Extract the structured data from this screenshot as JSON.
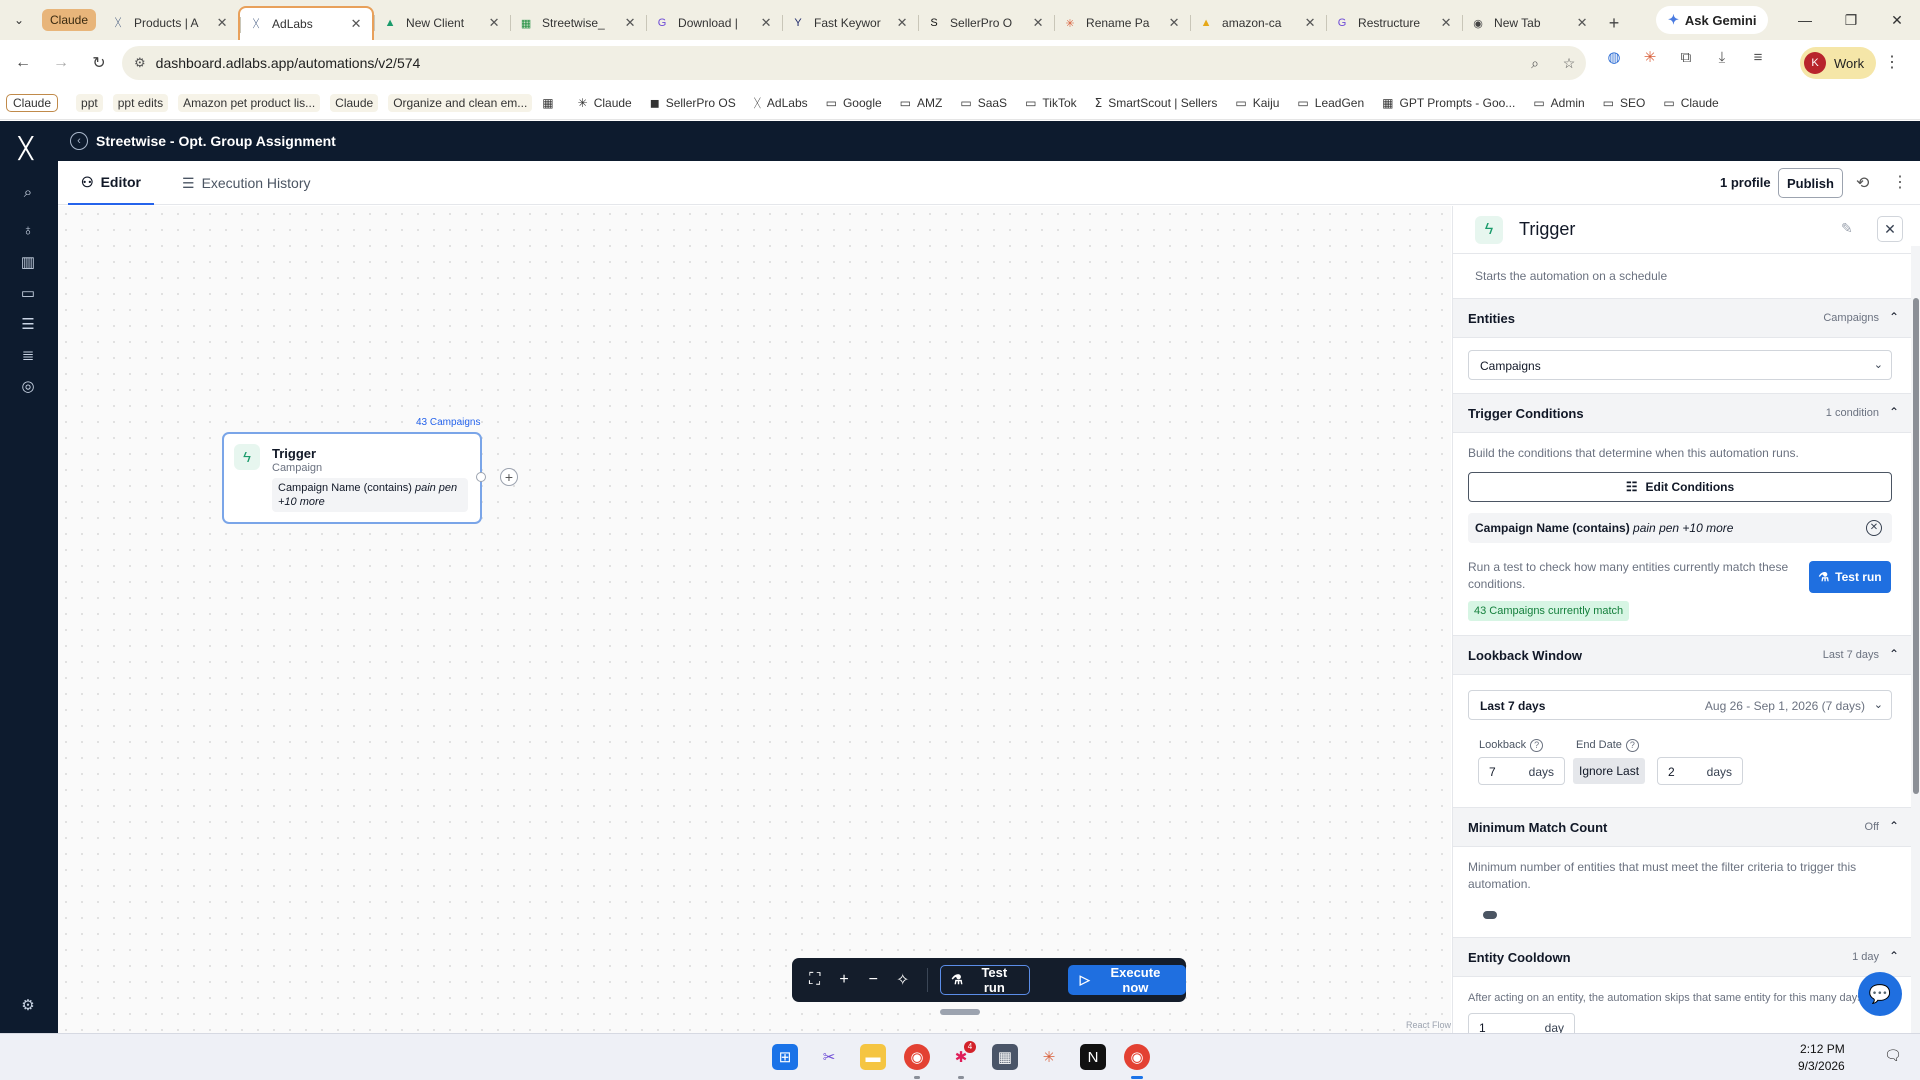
{
  "browser": {
    "tab_group_label": "Claude",
    "tabs": [
      {
        "title": "Products | A",
        "favicon": "adlabs-icon",
        "fav_char": "ᚷ",
        "fav_color": "#1f3a68",
        "active": false
      },
      {
        "title": "AdLabs",
        "favicon": "adlabs-icon",
        "fav_char": "ᚷ",
        "fav_color": "#1f3a68",
        "active": true
      },
      {
        "title": "New Client",
        "favicon": "google-drive-icon",
        "fav_char": "▲",
        "fav_color": "#1a9b6b",
        "active": false
      },
      {
        "title": "Streetwise_",
        "favicon": "google-sheets-icon",
        "fav_char": "▦",
        "fav_color": "#1e8e3e",
        "active": false
      },
      {
        "title": "Download |",
        "favicon": "g-icon",
        "fav_char": "G",
        "fav_color": "#6d4ad6",
        "active": false
      },
      {
        "title": "Fast Keywor",
        "favicon": "y-icon",
        "fav_char": "Y",
        "fav_color": "#1f2a6b",
        "active": false
      },
      {
        "title": "SellerPro O",
        "favicon": "sellerpro-icon",
        "fav_char": "S",
        "fav_color": "#111111",
        "active": false
      },
      {
        "title": "Rename Pa",
        "favicon": "claude-icon",
        "fav_char": "✳",
        "fav_color": "#d9613c",
        "active": false
      },
      {
        "title": "amazon-ca",
        "favicon": "google-drive-icon",
        "fav_char": "▲",
        "fav_color": "#e6a817",
        "active": false
      },
      {
        "title": "Restructure",
        "favicon": "g-icon",
        "fav_char": "G",
        "fav_color": "#6d4ad6",
        "active": false
      },
      {
        "title": "New Tab",
        "favicon": "chrome-icon",
        "fav_char": "◉",
        "fav_color": "#444444",
        "active": false
      }
    ],
    "ask_gemini": "Ask Gemini",
    "url": "dashboard.adlabs.app/automations/v2/574",
    "profile_initial": "K",
    "profile_name": "Work",
    "bookmarks": [
      {
        "label": "Claude",
        "icon": "",
        "style": "first"
      },
      {
        "label": "ppt",
        "icon": "",
        "style": "chip"
      },
      {
        "label": "ppt edits",
        "icon": "",
        "style": "chip"
      },
      {
        "label": "Amazon pet product lis...",
        "icon": "",
        "style": "chip"
      },
      {
        "label": "Claude",
        "icon": "",
        "style": "chip"
      },
      {
        "label": "Organize and clean em...",
        "icon": "",
        "style": "chip"
      },
      {
        "label": "",
        "icon": "▦",
        "style": "plain"
      },
      {
        "label": "Claude",
        "icon": "✳",
        "style": "plain"
      },
      {
        "label": "SellerPro OS",
        "icon": "◼",
        "style": "plain"
      },
      {
        "label": "AdLabs",
        "icon": "ᚷ",
        "style": "plain"
      },
      {
        "label": "Google",
        "icon": "▭",
        "style": "plain"
      },
      {
        "label": "AMZ",
        "icon": "▭",
        "style": "plain"
      },
      {
        "label": "SaaS",
        "icon": "▭",
        "style": "plain"
      },
      {
        "label": "TikTok",
        "icon": "▭",
        "style": "plain"
      },
      {
        "label": "SmartScout | Sellers",
        "icon": "ⵉ",
        "style": "plain"
      },
      {
        "label": "Kaiju",
        "icon": "▭",
        "style": "plain"
      },
      {
        "label": "LeadGen",
        "icon": "▭",
        "style": "plain"
      },
      {
        "label": "GPT Prompts - Goo...",
        "icon": "▦",
        "style": "plain"
      },
      {
        "label": "Admin",
        "icon": "▭",
        "style": "plain"
      },
      {
        "label": "SEO",
        "icon": "▭",
        "style": "plain"
      },
      {
        "label": "Claude",
        "icon": "▭",
        "style": "plain"
      }
    ]
  },
  "app": {
    "automation_title": "Streetwise - Opt. Group Assignment",
    "tabs": {
      "editor": "Editor",
      "history": "Execution History"
    },
    "profiles": "1 profile",
    "publish": "Publish"
  },
  "canvas": {
    "node_count": "43 Campaigns",
    "node_title": "Trigger",
    "node_subtitle": "Campaign",
    "node_condition": "Campaign Name (contains)",
    "node_condition_value": "pain pen",
    "node_condition_more": "+10 more",
    "react_flow": "React Flow",
    "toolbar_test": "Test run",
    "toolbar_execute": "Execute now"
  },
  "panel": {
    "title": "Trigger",
    "description": "Starts the automation on a schedule",
    "entities": {
      "heading": "Entities",
      "summary": "Campaigns",
      "selected": "Campaigns"
    },
    "conditions": {
      "heading": "Trigger Conditions",
      "summary": "1 condition",
      "help": "Build the conditions that determine when this automation runs.",
      "edit_button": "Edit Conditions",
      "chip_field": "Campaign Name (contains)",
      "chip_value": "pain pen +10 more",
      "test_help": "Run a test to check how many entities currently match these conditions.",
      "test_button": "Test run",
      "match_badge": "43 Campaigns currently match"
    },
    "lookback": {
      "heading": "Lookback Window",
      "summary": "Last 7 days",
      "selected": "Last 7 days",
      "range": "Aug 26 - Sep 1, 2026 (7 days)",
      "lookback_label": "Lookback",
      "lookback_value": "7",
      "lookback_unit": "days",
      "end_label": "End Date",
      "ignore_last": "Ignore Last",
      "end_value": "2",
      "end_unit": "days"
    },
    "min_match": {
      "heading": "Minimum Match Count",
      "summary": "Off",
      "help": "Minimum number of entities that must meet the filter criteria to trigger this automation.",
      "enabled": false
    },
    "cooldown": {
      "heading": "Entity Cooldown",
      "summary": "1 day",
      "help": "After acting on an entity, the automation skips that same entity for this many days.",
      "value": "1",
      "unit": "day"
    }
  },
  "taskbar": {
    "time": "2:12 PM",
    "date": "9/3/2026",
    "slack_badge": "4"
  }
}
